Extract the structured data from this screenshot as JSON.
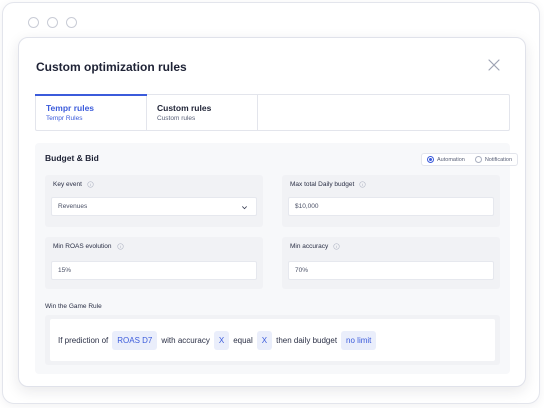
{
  "modal": {
    "title": "Custom optimization rules"
  },
  "tabs": [
    {
      "title": "Tempr rules",
      "subtitle": "Tempr Rules"
    },
    {
      "title": "Custom rules",
      "subtitle": "Custom rules"
    }
  ],
  "budget": {
    "title": "Budget & Bid",
    "mode_options": [
      {
        "label": "Automation",
        "selected": true
      },
      {
        "label": "Notification",
        "selected": false
      }
    ],
    "key_event": {
      "label": "Key event",
      "value": "Revenues"
    },
    "max_budget": {
      "label": "Max total Daily budget",
      "value": "$10,000"
    },
    "min_roas": {
      "label": "Min ROAS evolution",
      "value": "15%"
    },
    "min_accuracy": {
      "label": "Min accuracy",
      "value": "70%"
    }
  },
  "rule": {
    "label": "Win the Game Rule",
    "text_if": "If prediction of",
    "chip_metric": "ROAS D7",
    "text_accuracy": "with accuracy",
    "chip_accuracy": "X",
    "text_equal": "equal",
    "chip_equal": "X",
    "text_then": "then daily budget",
    "chip_budget": "no limit"
  },
  "colors": {
    "accent": "#3b5bdb",
    "chip_bg": "#eaeefb",
    "panel_bg": "#f7f8fa"
  },
  "icons": {
    "close": "close-icon",
    "info": "info-icon",
    "dropdown": "chevron-down-icon"
  }
}
